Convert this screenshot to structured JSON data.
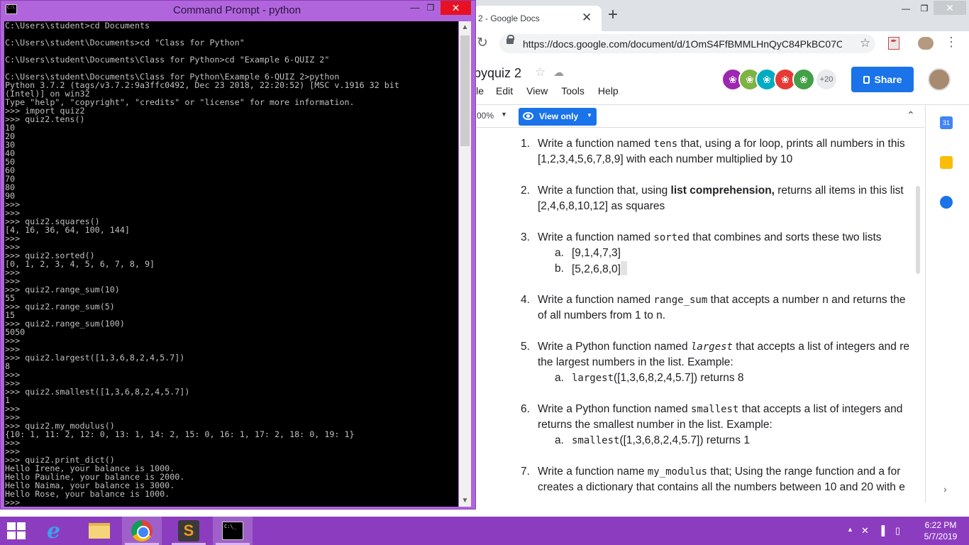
{
  "chrome": {
    "tab_title": "2 - Google Docs",
    "tab_close": "✕",
    "new_tab": "+",
    "url": "https://docs.google.com/document/d/1OmS4FfBMMLHnQyC84PkBC07O...",
    "window_min": "—",
    "window_max": "❐",
    "window_close": "✕"
  },
  "docs": {
    "title": "pyquiz 2",
    "menu": [
      "ile",
      "Edit",
      "View",
      "Tools",
      "Help"
    ],
    "collaborators_more": "+20",
    "share_label": "Share",
    "zoom": "00%",
    "mode_label": "View only",
    "side_calendar": "31",
    "items": [
      {
        "num": "1.",
        "line1_pre": "Write a function named ",
        "line1_code": "tens",
        "line1_post": " that, using a for loop, prints all numbers in this",
        "line2": "[1,2,3,4,5,6,7,8,9] with each number multiplied by 10"
      },
      {
        "num": "2.",
        "line1_pre": "Write a function that, using ",
        "line1_bold": "list comprehension,",
        "line1_post": " returns all items in this list",
        "line2": "[2,4,6,8,10,12] as squares"
      },
      {
        "num": "3.",
        "line1_pre": "Write a function named ",
        "line1_code": "sorted",
        "line1_post": " that combines and sorts these two lists",
        "sub_a_letter": "a.",
        "sub_a": "[9,1,4,7,3]",
        "sub_b_letter": "b.",
        "sub_b": "[5,2,6,8,0]"
      },
      {
        "num": "4.",
        "line1_pre": "Write a function named ",
        "line1_code": "range_sum",
        "line1_post": " that accepts a number n and returns the",
        "line2": "of all numbers from 1 to n."
      },
      {
        "num": "5.",
        "line1_pre": "Write a Python function named ",
        "line1_code": "largest",
        "line1_post": " that accepts a list of integers and re",
        "line2": "the largest numbers in the list.  Example:",
        "sub_a_letter": "a.",
        "sub_a_code": "largest",
        "sub_a": "([1,3,6,8,2,4,5.7]) returns 8"
      },
      {
        "num": "6.",
        "line1_pre": "Write a Python function named ",
        "line1_code": "smallest",
        "line1_post": " that accepts a list of integers and",
        "line2": "returns the smallest number in the list. Example:",
        "sub_a_letter": "a.",
        "sub_a_code": "smallest",
        "sub_a": "([1,3,6,8,2,4,5.7]) returns 1"
      },
      {
        "num": "7.",
        "line1_pre": "Write a function name ",
        "line1_code": "my_modulus",
        "line1_post": " that; Using the range function and a for",
        "line2": "creates a dictionary that contains all the numbers between 10 and 20 with e"
      }
    ]
  },
  "cmd": {
    "title": "Command Prompt - python",
    "min": "—",
    "max": "❐",
    "close": "✕",
    "output": "C:\\Users\\student>cd Documents\n\nC:\\Users\\student\\Documents>cd \"Class for Python\"\n\nC:\\Users\\student\\Documents\\Class for Python>cd \"Example 6-QUIZ 2\"\n\nC:\\Users\\student\\Documents\\Class for Python\\Example 6-QUIZ 2>python\nPython 3.7.2 (tags/v3.7.2:9a3ffc0492, Dec 23 2018, 22:20:52) [MSC v.1916 32 bit\n(Intel)] on win32\nType \"help\", \"copyright\", \"credits\" or \"license\" for more information.\n>>> import quiz2\n>>> quiz2.tens()\n10\n20\n30\n40\n50\n60\n70\n80\n90\n>>>\n>>>\n>>> quiz2.squares()\n[4, 16, 36, 64, 100, 144]\n>>>\n>>>\n>>> quiz2.sorted()\n[0, 1, 2, 3, 4, 5, 6, 7, 8, 9]\n>>>\n>>>\n>>> quiz2.range_sum(10)\n55\n>>> quiz2.range_sum(5)\n15\n>>> quiz2.range_sum(100)\n5050\n>>>\n>>>\n>>> quiz2.largest([1,3,6,8,2,4,5.7])\n8\n>>>\n>>>\n>>> quiz2.smallest([1,3,6,8,2,4,5.7])\n1\n>>>\n>>>\n>>> quiz2.my_modulus()\n{10: 1, 11: 2, 12: 0, 13: 1, 14: 2, 15: 0, 16: 1, 17: 2, 18: 0, 19: 1}\n>>>\n>>>\n>>> quiz2.print_dict()\nHello Irene, your balance is 1000.\nHello Pauline, your balance is 2000.\nHello Naima, your balance is 3000.\nHello Rose, your balance is 1000.\n>>>"
  },
  "taskbar": {
    "sublime_letter": "S",
    "cmd_glyph": "C:\\_",
    "time": "6:22 PM",
    "date": "5/7/2019"
  },
  "colors": {
    "cmd_frame": "#b065dc",
    "taskbar": "#8c3dbf",
    "docs_blue": "#1a73e8"
  },
  "icons": [
    "windows-start-icon",
    "internet-explorer-icon",
    "file-explorer-icon",
    "chrome-icon",
    "sublime-text-icon",
    "command-prompt-icon",
    "lock-icon",
    "star-icon",
    "reload-icon",
    "eye-icon",
    "calendar-icon",
    "keep-icon",
    "tasks-icon"
  ]
}
